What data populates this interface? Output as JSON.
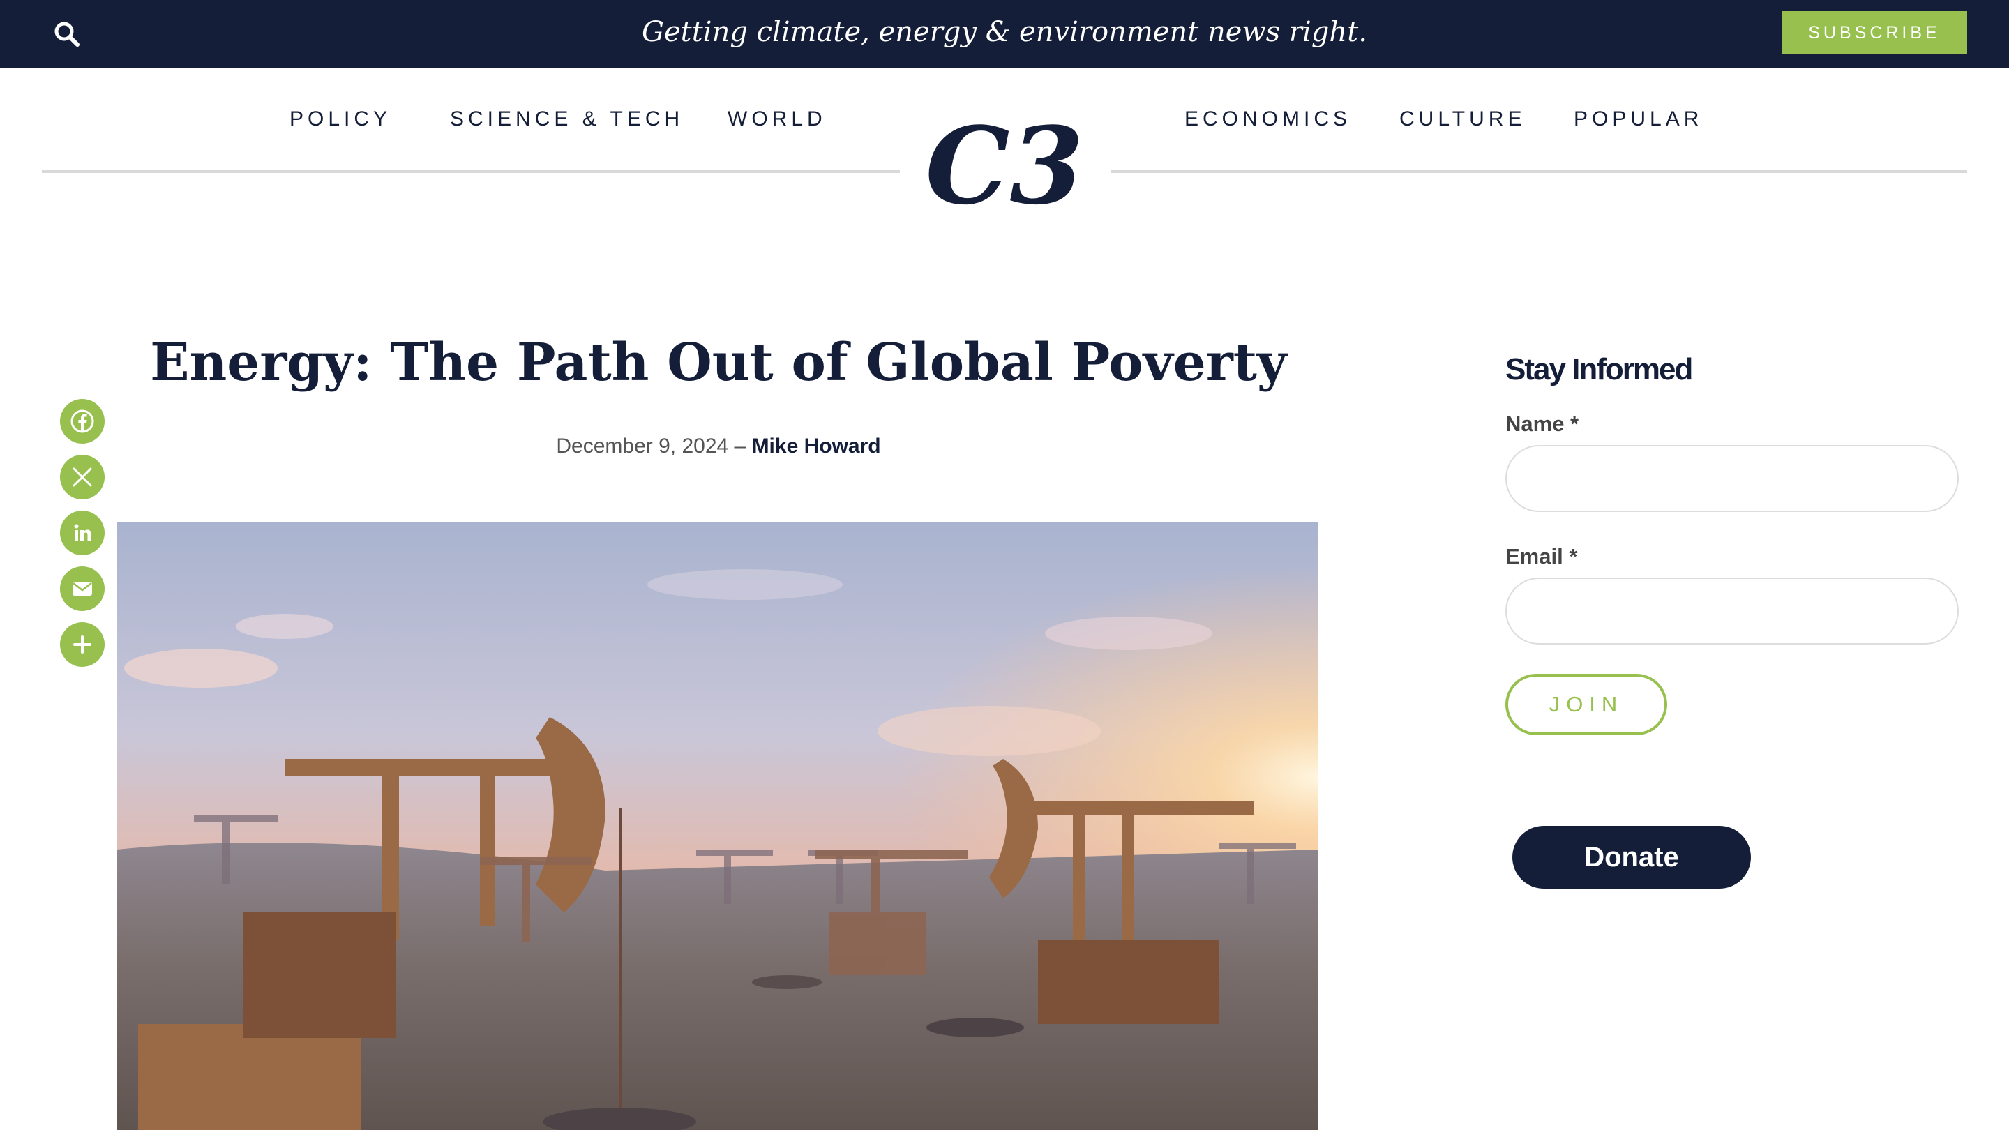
{
  "header": {
    "tagline": "Getting climate, energy & environment news right.",
    "subscribe_label": "SUBSCRIBE",
    "search_icon": "search-icon"
  },
  "nav": {
    "left": [
      "POLICY",
      "SCIENCE & TECH",
      "WORLD"
    ],
    "right": [
      "ECONOMICS",
      "CULTURE",
      "POPULAR"
    ],
    "logo": "C3"
  },
  "article": {
    "title": "Energy: The Path Out of Global Poverty",
    "date": "December 9, 2024",
    "separator": "–",
    "author": "Mike Howard",
    "image_alt": "Oil pump jacks in a desert field at sunset"
  },
  "share": {
    "icons": [
      "facebook-icon",
      "x-icon",
      "linkedin-icon",
      "email-icon",
      "plus-icon"
    ]
  },
  "sidebar": {
    "heading": "Stay Informed",
    "name_label": "Name *",
    "email_label": "Email *",
    "join_label": "JOIN",
    "donate_label": "Donate"
  },
  "colors": {
    "navy": "#141e38",
    "green": "#97c04f",
    "divider": "#d9d9d9"
  }
}
